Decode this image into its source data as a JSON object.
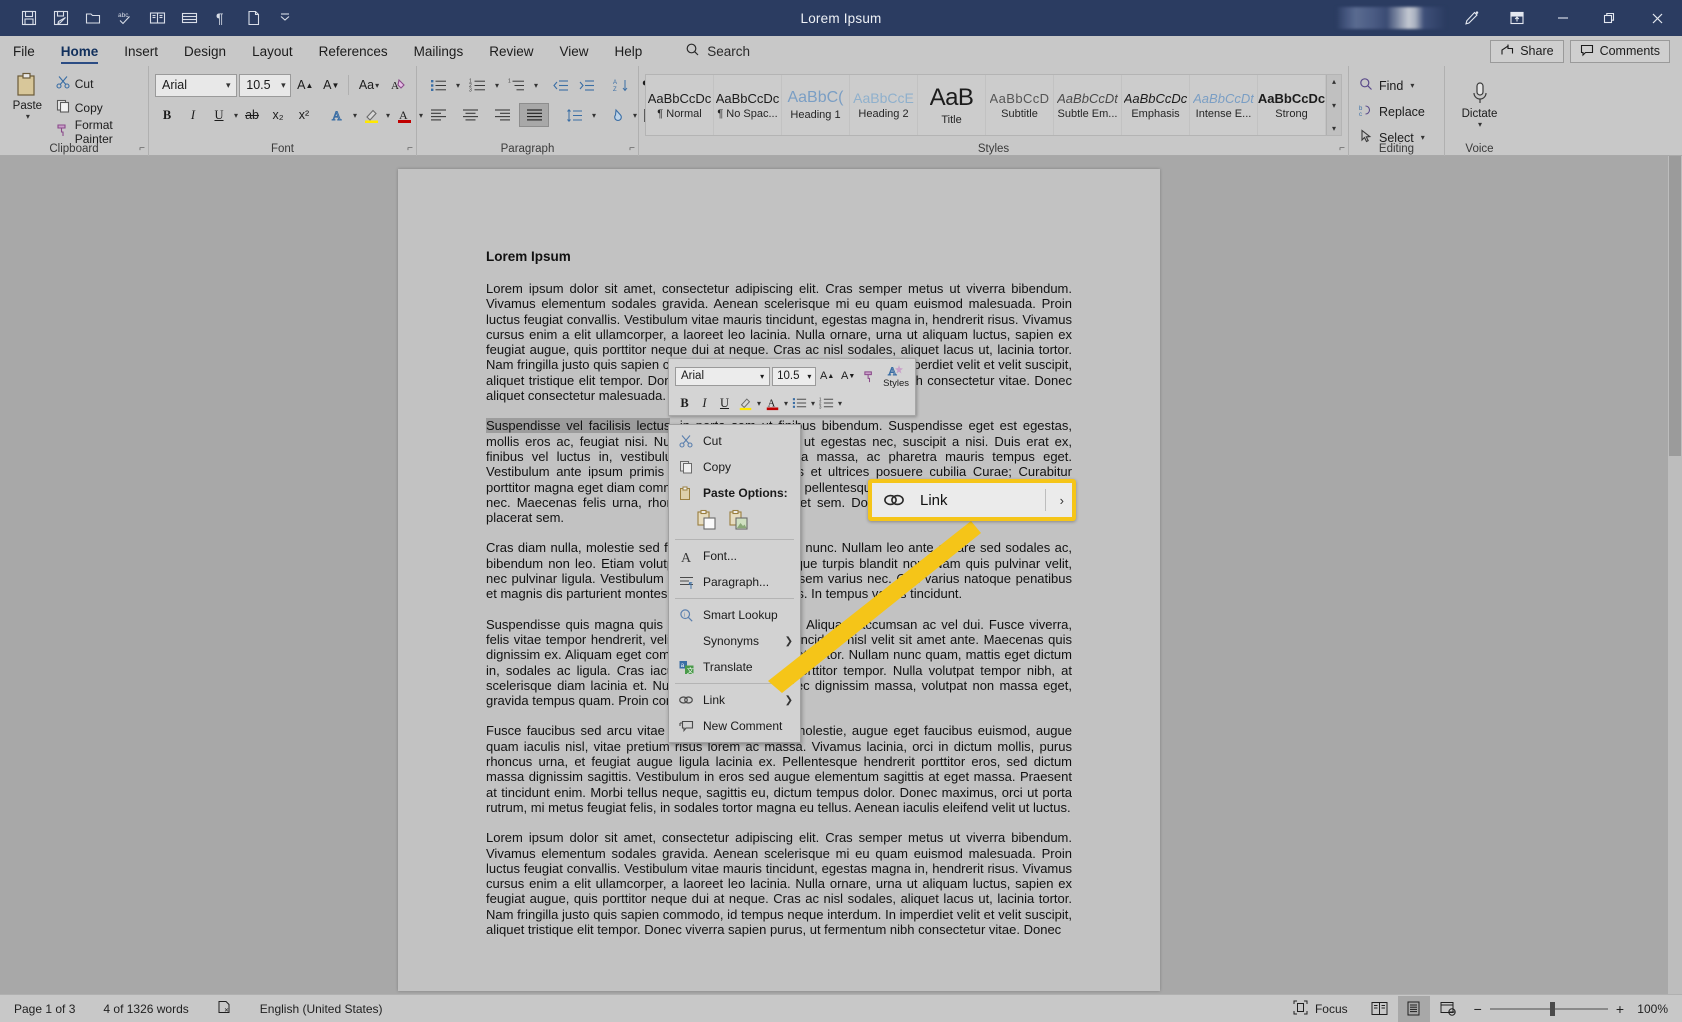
{
  "window": {
    "title": "Lorem Ipsum",
    "quick_access": [
      {
        "name": "save-icon",
        "label": "Save"
      },
      {
        "name": "save-as-icon",
        "label": "Save As"
      },
      {
        "name": "open-folder-icon",
        "label": "Open"
      },
      {
        "name": "spelling-check-icon",
        "label": "Spelling & Grammar"
      },
      {
        "name": "read-mode-icon",
        "label": "Read Mode"
      },
      {
        "name": "table-icon",
        "label": "Insert Table"
      },
      {
        "name": "paragraph-marks-icon",
        "label": "Show/Hide ¶"
      },
      {
        "name": "new-document-icon",
        "label": "New"
      },
      {
        "name": "customize-qat-icon",
        "label": "Customize Quick Access Toolbar"
      }
    ],
    "buttons": {
      "pen": "Draw",
      "ribbon_options": "Ribbon Display Options",
      "minimize": "Minimize",
      "restore": "Restore Down",
      "close": "Close"
    }
  },
  "tabs": [
    {
      "label": "File",
      "active": false
    },
    {
      "label": "Home",
      "active": true
    },
    {
      "label": "Insert",
      "active": false
    },
    {
      "label": "Design",
      "active": false
    },
    {
      "label": "Layout",
      "active": false
    },
    {
      "label": "References",
      "active": false
    },
    {
      "label": "Mailings",
      "active": false
    },
    {
      "label": "Review",
      "active": false
    },
    {
      "label": "View",
      "active": false
    },
    {
      "label": "Help",
      "active": false
    }
  ],
  "search": {
    "placeholder": "Search",
    "label": "Search"
  },
  "tabstrip_right": [
    {
      "label": "Share",
      "icon": "share-icon"
    },
    {
      "label": "Comments",
      "icon": "comment-icon"
    }
  ],
  "ribbon": {
    "clipboard": {
      "group_label": "Clipboard",
      "paste_label": "Paste",
      "items": [
        {
          "label": "Cut",
          "icon": "scissors-icon"
        },
        {
          "label": "Copy",
          "icon": "copy-icon"
        },
        {
          "label": "Format Painter",
          "icon": "format-painter-icon"
        }
      ]
    },
    "font": {
      "group_label": "Font",
      "font_family": "Arial",
      "font_size": "10.5",
      "buttons": [
        {
          "label": "B",
          "name": "bold-button"
        },
        {
          "label": "I",
          "name": "italic-button"
        },
        {
          "label": "U",
          "name": "underline-button"
        },
        {
          "label": "ab",
          "name": "strikethrough-button"
        },
        {
          "label": "x₂",
          "name": "subscript-button"
        },
        {
          "label": "x²",
          "name": "superscript-button"
        }
      ],
      "grow_font": "A",
      "shrink_font": "A",
      "change_case": "Aa"
    },
    "paragraph": {
      "group_label": "Paragraph"
    },
    "styles": {
      "group_label": "Styles",
      "items": [
        {
          "preview": "AaBbCcDc",
          "name": "¶ Normal"
        },
        {
          "preview": "AaBbCcDc",
          "name": "¶ No Spac..."
        },
        {
          "preview": "AaBbC(",
          "name": "Heading 1"
        },
        {
          "preview": "AaBbCcE",
          "name": "Heading 2"
        },
        {
          "preview": "AaB",
          "name": "Title"
        },
        {
          "preview": "AaBbCcD",
          "name": "Subtitle"
        },
        {
          "preview": "AaBbCcDt",
          "name": "Subtle Em..."
        },
        {
          "preview": "AaBbCcDc",
          "name": "Emphasis"
        },
        {
          "preview": "AaBbCcDt",
          "name": "Intense E..."
        },
        {
          "preview": "AaBbCcDc",
          "name": "Strong"
        }
      ]
    },
    "editing": {
      "group_label": "Editing",
      "items": [
        {
          "label": "Find",
          "icon": "search-icon"
        },
        {
          "label": "Replace",
          "icon": "replace-icon"
        },
        {
          "label": "Select",
          "icon": "cursor-icon"
        }
      ]
    },
    "voice": {
      "group_label": "Voice",
      "dictate_label": "Dictate"
    }
  },
  "document": {
    "heading": "Lorem Ipsum",
    "paragraphs": [
      {
        "selected_prefix": "",
        "text": "Lorem ipsum dolor sit amet, consectetur adipiscing elit. Cras semper metus ut viverra bibendum. Vivamus elementum sodales gravida. Aenean scelerisque mi eu quam euismod malesuada. Proin luctus feugiat convallis. Vestibulum vitae mauris tincidunt, egestas magna in, hendrerit risus. Vivamus cursus enim a elit ullamcorper, a laoreet leo lacinia. Nulla ornare, urna ut aliquam luctus, sapien ex feugiat augue, quis porttitor neque dui at neque. Cras ac nisl sodales, aliquet lacus ut, lacinia tortor. Nam fringilla justo quis sapien commodo, id tempus neque interdum. In imperdiet velit et velit suscipit, aliquet tristique elit tempor. Donec viverra sapien purus, ut fermentum nibh consectetur vitae. Donec aliquet consectetur malesuada."
      },
      {
        "selected_prefix": "Suspendisse vel facilisis lectus",
        "text": ", in porta sem ut finibus bibendum. Suspendisse eget est egestas, mollis eros ac, feugiat nisi. Nulla facilisi. Vestibulum ut egestas nec, suscipit a nisi. Duis erat ex, finibus vel luctus in, vestibulum quis purus. Viverra massa, ac pharetra mauris tempus eget. Vestibulum ante ipsum primis in faucibus orci luctus et ultrices posuere cubilia Curae; Curabitur porttitor magna eget diam commodo, ut tincidunt ligula pellentesque. Donec vitae felis ut erat tristique nec. Maecenas felis urna, rhoncus quam quis, aliquet sem. Donec erat sem, rhoncus lacus, non placerat sem."
      },
      {
        "selected_prefix": "",
        "text": "Cras diam nulla, molestie sed felis in, porttitor tempus nunc. Nullam leo ante ornare sed sodales ac, bibendum non leo. Etiam volutpat eros tempus, tristique turpis blandit non. Nam quis pulvinar velit, nec pulvinar ligula. Vestibulum dictum nibh, ut mattis sem varius nec. Orci varius natoque penatibus et magnis dis parturient montes, nascetur ridiculus mus. In tempus varius tincidunt."
      },
      {
        "selected_prefix": "",
        "text": "Suspendisse quis magna quis nunc pulvinar rhoncus. Aliquam accumsan ac vel dui. Fusce viverra, felis vitae tempor hendrerit, velit mi volutpat risus, a tincidunt nisl velit sit amet ante. Maecenas quis dignissim ex. Aliquam eget commodo neque, eu aliquet tortor. Nullam nunc quam, mattis eget dictum in, sodales ac ligula. Cras iaculis sem vitae tortor porttitor tempor. Nulla volutpat tempor nibh, at scelerisque diam lacinia et. Nunc at eros diam. Donec dignissim massa, volutpat non massa eget, gravida tempus quam. Proin consectetur convallis."
      },
      {
        "selected_prefix": "",
        "text": "Fusce faucibus sed arcu vitae suscipit. Sed cursus molestie, augue eget faucibus euismod, augue quam iaculis nisl, vitae pretium risus lorem ac massa. Vivamus lacinia, orci in dictum mollis, purus rhoncus urna, et feugiat augue ligula lacinia ex. Pellentesque hendrerit porttitor eros, sed dictum massa dignissim sagittis. Vestibulum in eros sed augue elementum sagittis at eget massa. Praesent at tincidunt enim. Morbi tellus neque, sagittis eu, dictum tempus dolor. Donec maximus, orci ut porta rutrum, mi metus feugiat felis, in sodales tortor magna eu tellus. Aenean iaculis eleifend velit ut luctus."
      },
      {
        "selected_prefix": "",
        "text": "Lorem ipsum dolor sit amet, consectetur adipiscing elit. Cras semper metus ut viverra bibendum. Vivamus elementum sodales gravida. Aenean scelerisque mi eu quam euismod malesuada. Proin luctus feugiat convallis. Vestibulum vitae mauris tincidunt, egestas magna in, hendrerit risus. Vivamus cursus enim a elit ullamcorper, a laoreet leo lacinia. Nulla ornare, urna ut aliquam luctus, sapien ex feugiat augue, quis porttitor neque dui at neque. Cras ac nisl sodales, aliquet lacus ut, lacinia tortor. Nam fringilla justo quis sapien commodo, id tempus neque interdum. In imperdiet velit et velit suscipit, aliquet tristique elit tempor. Donec viverra sapien purus, ut fermentum nibh consectetur vitae. Donec"
      }
    ]
  },
  "mini_toolbar": {
    "font_family": "Arial",
    "font_size": "10.5",
    "grow_font": "A",
    "shrink_font": "A",
    "styles_label": "Styles",
    "buttons": [
      "B",
      "I",
      "U"
    ]
  },
  "context_menu": {
    "items": [
      {
        "label": "Cut",
        "icon": "scissors-icon",
        "bold": false,
        "submenu": false
      },
      {
        "label": "Copy",
        "icon": "copy-icon",
        "bold": false,
        "submenu": false
      },
      {
        "label": "Paste Options:",
        "icon": "paste-icon",
        "bold": true,
        "submenu": false
      },
      {
        "label": "Font...",
        "icon": "font-icon",
        "bold": false,
        "submenu": false
      },
      {
        "label": "Paragraph...",
        "icon": "paragraph-icon",
        "bold": false,
        "submenu": false
      },
      {
        "label": "Smart Lookup",
        "icon": "smart-lookup-icon",
        "bold": false,
        "submenu": false
      },
      {
        "label": "Synonyms",
        "icon": "",
        "bold": false,
        "submenu": true
      },
      {
        "label": "Translate",
        "icon": "translate-icon",
        "bold": false,
        "submenu": false
      },
      {
        "label": "Link",
        "icon": "link-icon",
        "bold": false,
        "submenu": true
      },
      {
        "label": "New Comment",
        "icon": "new-comment-icon",
        "bold": false,
        "submenu": false
      }
    ],
    "paste_option_icons": [
      "paste-keep-formatting-icon",
      "paste-picture-icon"
    ]
  },
  "callout": {
    "label": "Link",
    "icon": "link-icon",
    "arrow": "›",
    "highlight_color": "#f5c518"
  },
  "status_bar": {
    "page": "Page 1 of 3",
    "words": "4 of 1326 words",
    "proofing_icon": "proofing-errors-icon",
    "language": "English (United States)",
    "focus_label": "Focus",
    "views": [
      {
        "name": "read-mode-view",
        "active": false
      },
      {
        "name": "print-layout-view",
        "active": true
      },
      {
        "name": "web-layout-view",
        "active": false
      }
    ],
    "zoom_out": "−",
    "zoom_in": "+",
    "zoom_level": "100%"
  }
}
